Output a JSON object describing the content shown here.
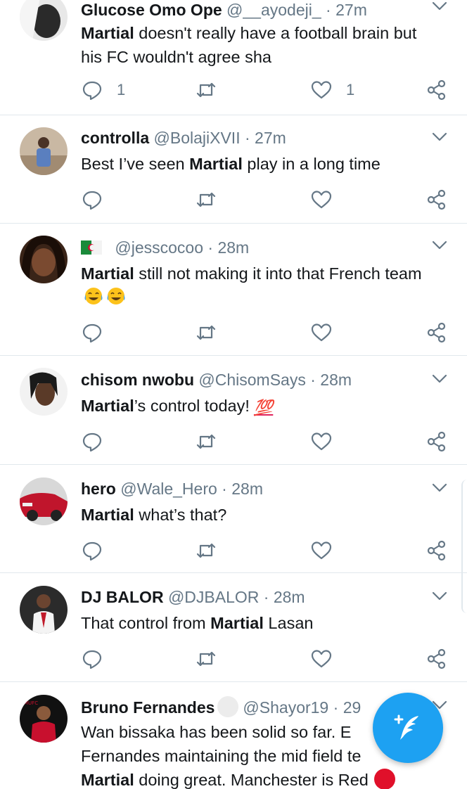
{
  "tweets": [
    {
      "display_name": "Glucose Omo Ope",
      "handle": "@__ayodeji_",
      "time": "27m",
      "text_bold": "Martial",
      "text_rest": " doesn't really have a football brain but his FC wouldn't agree sha",
      "reply_count": "1",
      "like_count": "1"
    },
    {
      "display_name": "controlla",
      "handle": "@BolajiXVII",
      "time": "27m",
      "text_pre": "Best I’ve seen ",
      "text_bold": "Martial",
      "text_rest": " play in a long time"
    },
    {
      "display_name": "",
      "handle": "@jesscocoo",
      "time": "28m",
      "text_bold": "Martial",
      "text_rest": " still not making it into that French team"
    },
    {
      "display_name": "chisom nwobu",
      "handle": "@ChisomSays",
      "time": "28m",
      "text_bold": "Martial",
      "text_rest": "’s control today!",
      "emoji": "💯"
    },
    {
      "display_name": "hero",
      "handle": "@Wale_Hero",
      "time": "28m",
      "text_bold": "Martial",
      "text_rest": " what’s that?"
    },
    {
      "display_name": "DJ BALOR",
      "handle": "@DJBALOR",
      "time": "28m",
      "text_pre": "That control from ",
      "text_bold": "Martial",
      "text_rest": " Lasan"
    },
    {
      "display_name": "Bruno Fernandes",
      "handle": "@Shayor19",
      "time": "29",
      "line1": "Wan bissaka has been solid so far.  E",
      "line2": "Fernandes maintaining the mid field te",
      "line3_bold": "Martial",
      "line3_rest": " doing great.  Manchester is Red"
    }
  ],
  "separator": "·",
  "icons": {
    "reply": "reply-icon",
    "retweet": "retweet-icon",
    "like": "heart-icon",
    "share": "share-icon",
    "caret": "chevron-down-icon",
    "compose": "compose-tweet-icon",
    "flag": "algeria-flag-icon"
  },
  "colors": {
    "accent": "#1da1f2",
    "icon_gray": "#657786",
    "divider": "#e1e8ed"
  }
}
